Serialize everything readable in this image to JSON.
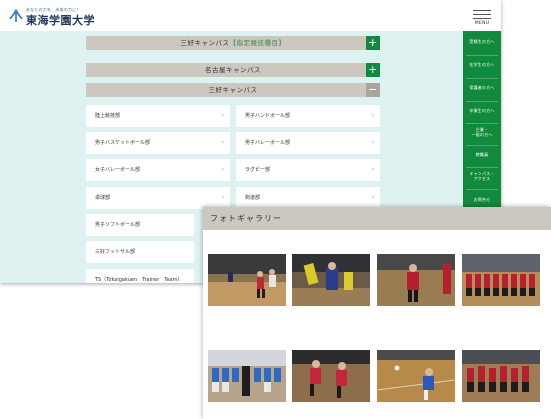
{
  "header": {
    "tagline": "あなたの力を、未来の力に！",
    "university_name": "東海学園大学",
    "menu_label": "MENU"
  },
  "accordions": [
    {
      "label": "三好キャンパス",
      "tag": "【指定競技種目】",
      "state": "+"
    },
    {
      "label": "名古屋キャンパス",
      "tag": "",
      "state": "+"
    },
    {
      "label": "三好キャンパス",
      "tag": "",
      "state": "−"
    }
  ],
  "clubs": [
    "陸上競技部",
    "男子ハンドボール部",
    "男子バスケットボール部",
    "男子バレーボール部",
    "女子バレーボール部",
    "ラグビー部",
    "卓球部",
    "剣道部",
    "男子ソフトボール部",
    "三好フットサル部",
    "TS（Tokaigakuen　Trainer　Team）"
  ],
  "club_arrow": "›",
  "side_nav": [
    "受験生の方へ",
    "在学生の方へ",
    "保護者の方へ",
    "卒業生の方へ",
    "企業・\n一般の方へ",
    "教職員",
    "キャンパス・\nアクセス",
    "お問合せ"
  ],
  "gallery": {
    "title": "フォトギャラリー",
    "photos": [
      "handball-photo-1",
      "volleyball-photo-1",
      "handball-photo-2",
      "team-group-photo-1",
      "team-group-photo-2",
      "handball-photo-3",
      "handball-photo-4",
      "team-group-photo-3"
    ]
  },
  "colors": {
    "brand_green": "#128a3e",
    "panel_beige": "#cdc8bf",
    "content_bg": "#dff2f2",
    "tag_green": "#2e8b57"
  }
}
